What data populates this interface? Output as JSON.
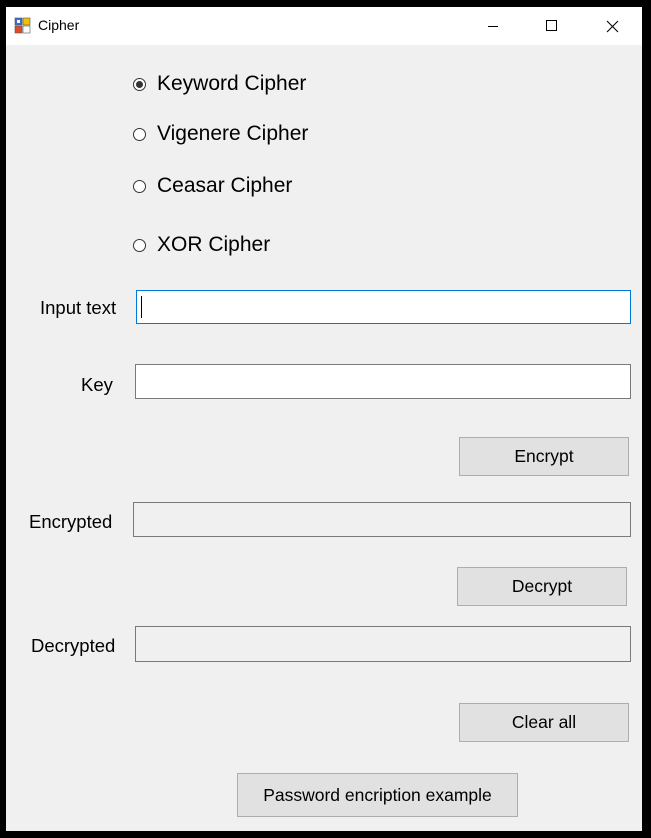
{
  "window": {
    "title": "Cipher"
  },
  "title_buttons": {
    "minimize": "minimize-icon",
    "maximize": "maximize-icon",
    "close": "close-icon"
  },
  "cipher_options": [
    {
      "label": "Keyword Cipher",
      "selected": true
    },
    {
      "label": "Vigenere Cipher",
      "selected": false
    },
    {
      "label": "Ceasar Cipher",
      "selected": false
    },
    {
      "label": "XOR Cipher",
      "selected": false
    }
  ],
  "fields": {
    "input_text": {
      "label": "Input text",
      "value": ""
    },
    "key": {
      "label": "Key",
      "value": ""
    },
    "encrypted": {
      "label": "Encrypted",
      "value": ""
    },
    "decrypted": {
      "label": "Decrypted",
      "value": ""
    }
  },
  "buttons": {
    "encrypt": "Encrypt",
    "decrypt": "Decrypt",
    "clear_all": "Clear all",
    "password_example": "Password encription example"
  },
  "colors": {
    "focus_border": "#0078d7",
    "window_bg": "#f0f0f0",
    "button_bg": "#e1e1e1"
  }
}
